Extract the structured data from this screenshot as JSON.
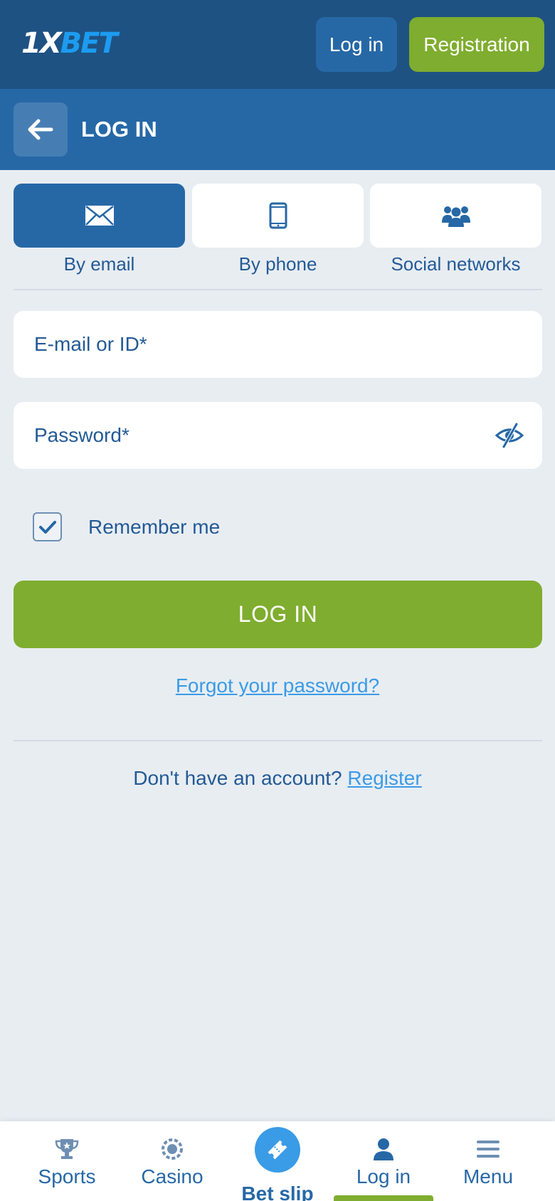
{
  "header": {
    "logo_prefix": "1X",
    "logo_suffix": "BET",
    "login_label": "Log in",
    "registration_label": "Registration"
  },
  "titlebar": {
    "title": "LOG IN"
  },
  "tabs": [
    {
      "label": "By email",
      "icon": "envelope-icon",
      "active": true
    },
    {
      "label": "By phone",
      "icon": "phone-icon",
      "active": false
    },
    {
      "label": "Social networks",
      "icon": "users-icon",
      "active": false
    }
  ],
  "form": {
    "email_placeholder": "E-mail or ID*",
    "email_value": "",
    "password_placeholder": "Password*",
    "password_value": "",
    "remember_label": "Remember me",
    "remember_checked": true,
    "submit_label": "LOG IN",
    "forgot_label": "Forgot your password?",
    "no_account_text": "Don't have an account?",
    "register_link": "Register"
  },
  "bottom_nav": {
    "items": [
      {
        "label": "Sports",
        "icon": "trophy-icon"
      },
      {
        "label": "Casino",
        "icon": "casino-chip-icon"
      },
      {
        "label": "Bet slip",
        "icon": "ticket-icon"
      },
      {
        "label": "Log in",
        "icon": "user-icon",
        "active": true
      },
      {
        "label": "Menu",
        "icon": "hamburger-icon"
      }
    ]
  },
  "colors": {
    "header_bg": "#1e5283",
    "titlebar_bg": "#2668a6",
    "accent_green": "#7fad2f",
    "link_blue": "#3a9be6",
    "text_blue": "#235a96",
    "page_bg": "#e8edf2"
  }
}
